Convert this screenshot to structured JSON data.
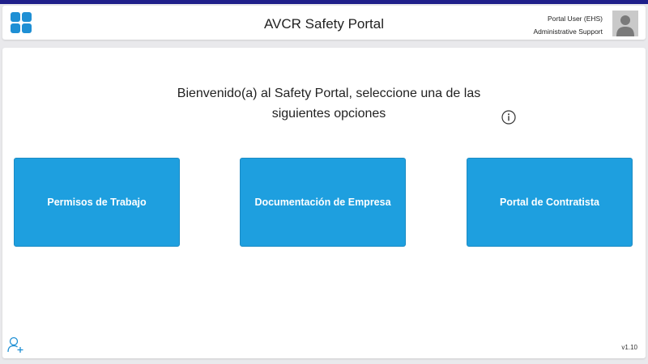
{
  "header": {
    "app_title": "AVCR Safety Portal",
    "user_name": "Portal User (EHS)",
    "user_role": "Administrative Support",
    "menu_icon": "apps-grid-icon",
    "avatar_icon": "user-avatar-icon"
  },
  "main": {
    "welcome_line1": "Bienvenido(a) al Safety Portal, seleccione una de las",
    "welcome_line2": "siguientes opciones",
    "info_icon": "info-icon",
    "tiles": [
      {
        "label": "Permisos de Trabajo"
      },
      {
        "label": "Documentación de Empresa"
      },
      {
        "label": "Portal de Contratista"
      }
    ]
  },
  "footer": {
    "add_user_icon": "add-user-icon",
    "version": "v1.10"
  },
  "colors": {
    "accent": "#1e9fdf",
    "top_stripe": "#1f1f8a",
    "icon_blue": "#1e8fd4"
  }
}
